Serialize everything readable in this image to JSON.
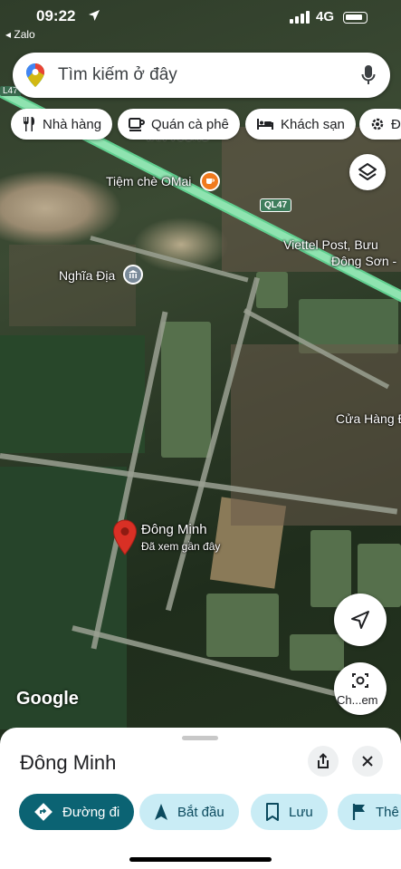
{
  "status_bar": {
    "time": "09:22",
    "back_app": "◂ Zalo",
    "network": "4G"
  },
  "search": {
    "placeholder": "Tìm kiếm ở đây"
  },
  "chips": [
    {
      "label": "Nhà hàng",
      "icon": "fork-knife-icon"
    },
    {
      "label": "Quán cà phê",
      "icon": "coffee-cup-icon"
    },
    {
      "label": "Khách sạn",
      "icon": "bed-icon"
    },
    {
      "label": "Đ",
      "icon": "gear-icon"
    }
  ],
  "map": {
    "labels": {
      "highway_top": "L47",
      "highway_badge": "QL47",
      "van_vuong": "VAN VUONG",
      "tiem_che": "Tiệm chè OMai",
      "viettel": "Viettel Post, Bưu",
      "dong_son": "Đông Sơn -",
      "nghia_dia": "Nghĩa Địa",
      "cua_hang": "Cửa Hàng Đ",
      "dong_minh": "Đông Minh",
      "recent": "Đã xem gần đây",
      "layers_label": "Ch...em"
    },
    "attribution": "Google",
    "pin_color": "#d93025",
    "highway_color": "#8fe3b0"
  },
  "sheet": {
    "title": "Đông Minh",
    "actions": [
      {
        "label": "Đường đi",
        "icon": "directions-icon"
      },
      {
        "label": "Bắt đầu",
        "icon": "navigation-arrow-icon"
      },
      {
        "label": "Lưu",
        "icon": "bookmark-icon"
      },
      {
        "label": "Thê",
        "icon": "flag-icon"
      }
    ]
  }
}
